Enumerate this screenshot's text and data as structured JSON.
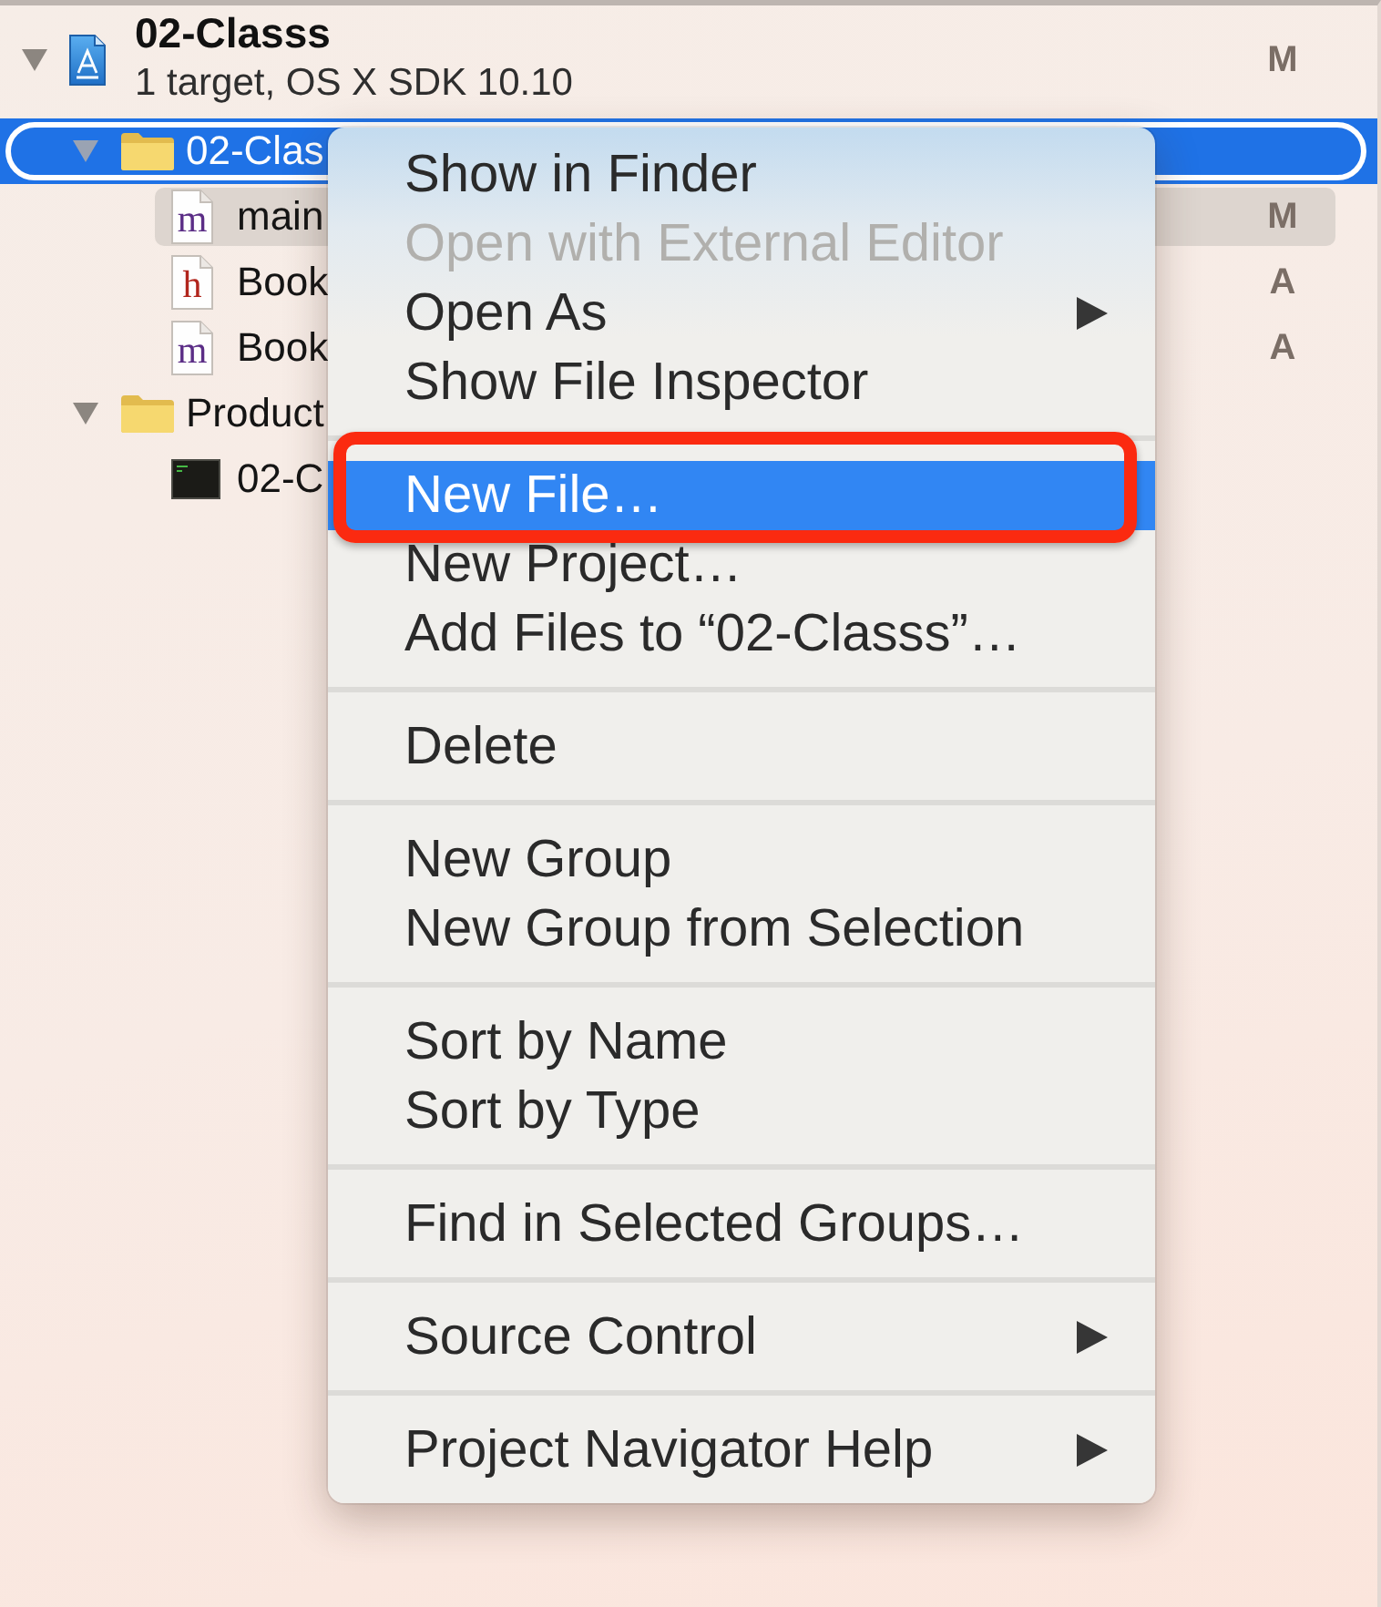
{
  "project": {
    "name": "02-Classs",
    "subtitle": "1 target, OS X SDK 10.10",
    "expanded": true,
    "status": "M"
  },
  "tree": [
    {
      "kind": "folder",
      "name": "02-Clas",
      "expanded": true,
      "selected": false,
      "context_clicked": true,
      "children": [
        {
          "kind": "source",
          "letter": "m",
          "name": "main",
          "status": "M",
          "selected": true,
          "context_clicked": false
        },
        {
          "kind": "header",
          "letter": "h",
          "name": "Book",
          "status": "A",
          "selected": false,
          "context_clicked": false
        },
        {
          "kind": "source",
          "letter": "m",
          "name": "Book",
          "status": "A",
          "selected": false,
          "context_clicked": false
        }
      ]
    },
    {
      "kind": "folder",
      "name": "Product",
      "expanded": true,
      "selected": false,
      "context_clicked": false,
      "children": [
        {
          "kind": "executable",
          "name": "02-C",
          "selected": false,
          "context_clicked": false
        }
      ]
    }
  ],
  "context_menu": {
    "sections": [
      {
        "items": [
          {
            "label": "Show in Finder",
            "disabled": false,
            "selected": false,
            "submenu": false,
            "annotated": false
          },
          {
            "label": "Open with External Editor",
            "disabled": true,
            "selected": false,
            "submenu": false,
            "annotated": false
          },
          {
            "label": "Open As",
            "disabled": false,
            "selected": false,
            "submenu": true,
            "annotated": false
          },
          {
            "label": "Show File Inspector",
            "disabled": false,
            "selected": false,
            "submenu": false,
            "annotated": false
          }
        ]
      },
      {
        "items": [
          {
            "label": "New File…",
            "disabled": false,
            "selected": true,
            "submenu": false,
            "annotated": true
          },
          {
            "label": "New Project…",
            "disabled": false,
            "selected": false,
            "submenu": false,
            "annotated": false
          },
          {
            "label": "Add Files to “02-Classs”…",
            "disabled": false,
            "selected": false,
            "submenu": false,
            "annotated": false
          }
        ]
      },
      {
        "items": [
          {
            "label": "Delete",
            "disabled": false,
            "selected": false,
            "submenu": false,
            "annotated": false
          }
        ]
      },
      {
        "items": [
          {
            "label": "New Group",
            "disabled": false,
            "selected": false,
            "submenu": false,
            "annotated": false
          },
          {
            "label": "New Group from Selection",
            "disabled": false,
            "selected": false,
            "submenu": false,
            "annotated": false
          }
        ]
      },
      {
        "items": [
          {
            "label": "Sort by Name",
            "disabled": false,
            "selected": false,
            "submenu": false,
            "annotated": false
          },
          {
            "label": "Sort by Type",
            "disabled": false,
            "selected": false,
            "submenu": false,
            "annotated": false
          }
        ]
      },
      {
        "items": [
          {
            "label": "Find in Selected Groups…",
            "disabled": false,
            "selected": false,
            "submenu": false,
            "annotated": false
          }
        ]
      },
      {
        "items": [
          {
            "label": "Source Control",
            "disabled": false,
            "selected": false,
            "submenu": true,
            "annotated": false
          }
        ]
      },
      {
        "items": [
          {
            "label": "Project Navigator Help",
            "disabled": false,
            "selected": false,
            "submenu": true,
            "annotated": false
          }
        ]
      }
    ]
  }
}
